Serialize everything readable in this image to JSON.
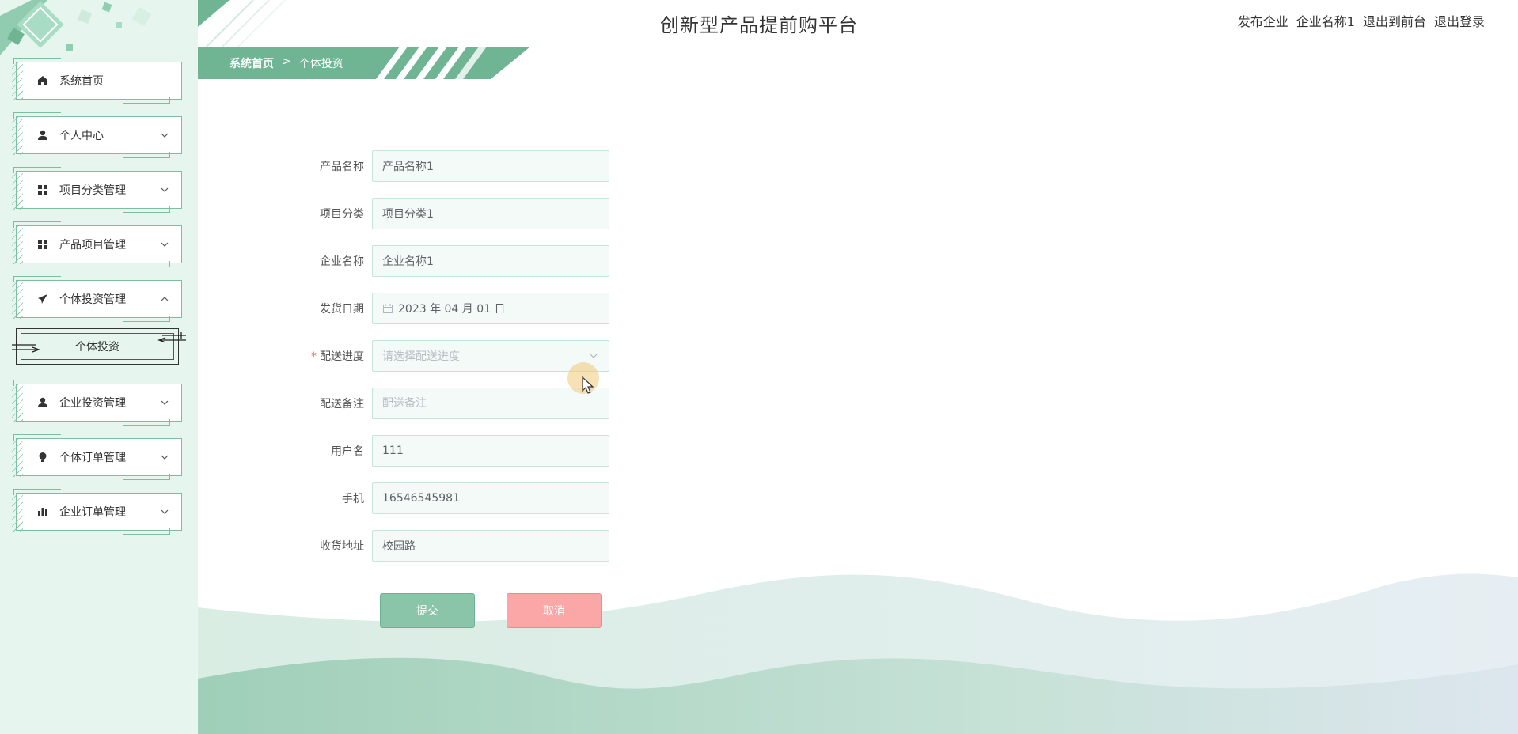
{
  "header": {
    "title": "创新型产品提前购平台",
    "role": "发布企业",
    "company": "企业名称1",
    "back_front": "退出到前台",
    "logout": "退出登录"
  },
  "breadcrumb": {
    "home": "系统首页",
    "separator": ">",
    "current": "个体投资"
  },
  "sidebar": {
    "items": [
      {
        "label": "系统首页",
        "icon": "home-icon",
        "expandable": false
      },
      {
        "label": "个人中心",
        "icon": "user-icon",
        "expandable": true
      },
      {
        "label": "项目分类管理",
        "icon": "grid-icon",
        "expandable": true
      },
      {
        "label": "产品项目管理",
        "icon": "grid-icon",
        "expandable": true
      },
      {
        "label": "个体投资管理",
        "icon": "send-icon",
        "expandable": true,
        "expanded": true
      },
      {
        "label": "企业投资管理",
        "icon": "user-icon",
        "expandable": true
      },
      {
        "label": "个体订单管理",
        "icon": "bulb-icon",
        "expandable": true
      },
      {
        "label": "企业订单管理",
        "icon": "bar-chart-icon",
        "expandable": true
      }
    ],
    "sub_item": "个体投资"
  },
  "form": {
    "product_name": {
      "label": "产品名称",
      "value": "产品名称1"
    },
    "category": {
      "label": "项目分类",
      "value": "项目分类1"
    },
    "company_name": {
      "label": "企业名称",
      "value": "企业名称1"
    },
    "ship_date": {
      "label": "发货日期",
      "value": "2023 年 04 月 01 日"
    },
    "delivery_progress": {
      "label": "配送进度",
      "required_mark": "*",
      "placeholder": "请选择配送进度"
    },
    "delivery_note": {
      "label": "配送备注",
      "placeholder": "配送备注"
    },
    "username": {
      "label": "用户名",
      "value": "111"
    },
    "phone": {
      "label": "手机",
      "value": "16546545981"
    },
    "address": {
      "label": "收货地址",
      "value": "校园路"
    }
  },
  "buttons": {
    "submit": "提交",
    "cancel": "取消"
  },
  "colors": {
    "accent": "#6fb593",
    "sidebar_bg": "#e6f5ee",
    "submit_bg": "#8ac5aa",
    "cancel_bg": "#fba7a7"
  }
}
